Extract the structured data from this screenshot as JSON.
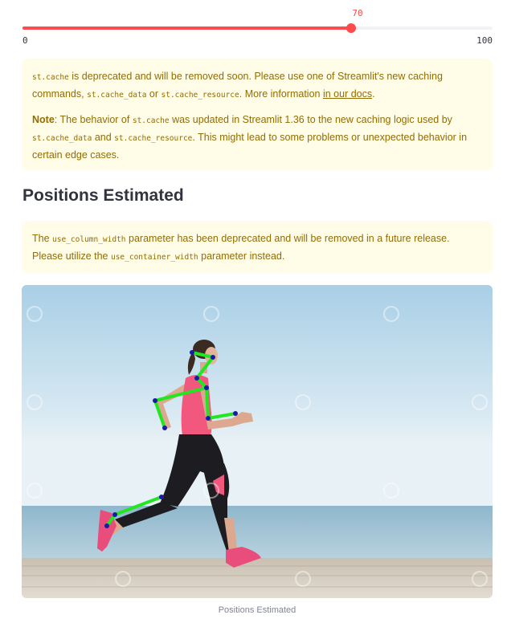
{
  "slider": {
    "value": "70",
    "min": "0",
    "max": "100",
    "fraction": 0.7,
    "color": "#ff4b4b"
  },
  "alert1": {
    "p1_code1": "st.cache",
    "p1_text1": " is deprecated and will be removed soon. Please use one of Streamlit's new caching commands, ",
    "p1_code2": "st.cache_data",
    "p1_text2": " or ",
    "p1_code3": "st.cache_resource",
    "p1_text3": ". More information ",
    "p1_link": "in our docs",
    "p1_text4": ".",
    "p2_bold": "Note",
    "p2_text1": ": The behavior of ",
    "p2_code1": "st.cache",
    "p2_text2": " was updated in Streamlit 1.36 to the new caching logic used by ",
    "p2_code2": "st.cache_data",
    "p2_text3": " and ",
    "p2_code3": "st.cache_resource",
    "p2_text4": ". This might lead to some problems or unexpected behavior in certain edge cases."
  },
  "heading": "Positions Estimated",
  "alert2": {
    "text1": "The ",
    "code1": "use_column_width",
    "text2": " parameter has been deprecated and will be removed in a future release. Please utilize the ",
    "code2": "use_container_width",
    "text3": " parameter instead."
  },
  "image": {
    "icon": "pose-estimation-image"
  },
  "caption": "Positions Estimated",
  "colors": {
    "accent": "#ff4b4b",
    "warning_bg": "#fffce7",
    "warning_text": "#926c05",
    "skeleton": "#22e622",
    "joint": "#1a1aa8"
  }
}
